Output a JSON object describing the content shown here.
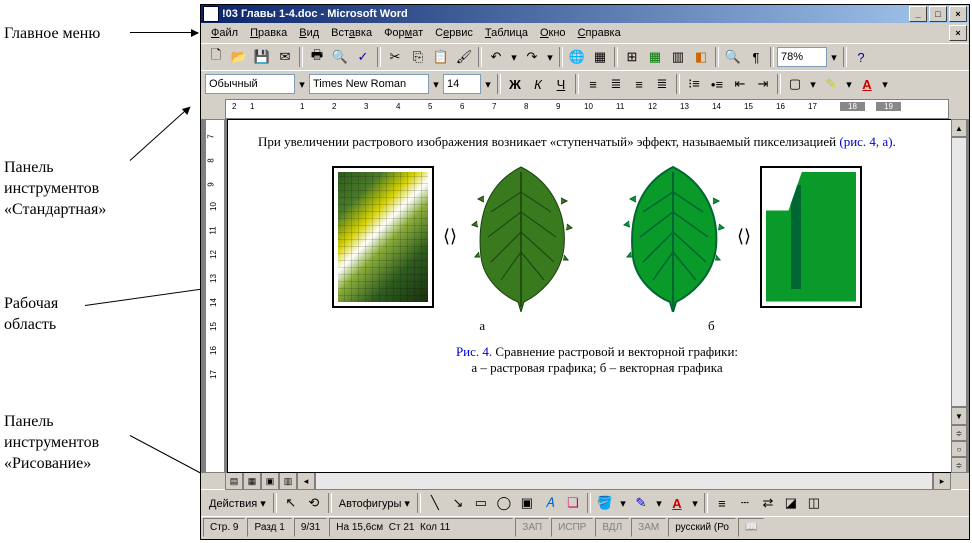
{
  "annotations": {
    "menu": "Главное меню",
    "standard": "Панель\nинструментов\n«Стандартная»",
    "workarea": "Рабочая\nобласть",
    "drawing": "Панель\nинструментов\n«Рисование»"
  },
  "title": "!03 Главы 1-4.doc - Microsoft Word",
  "menus": [
    "Файл",
    "Правка",
    "Вид",
    "Вставка",
    "Формат",
    "Сервис",
    "Таблица",
    "Окно",
    "Справка"
  ],
  "standard_toolbar": {
    "zoom": "78%"
  },
  "format_toolbar": {
    "style": "Обычный",
    "font": "Times New Roman",
    "size": "14"
  },
  "document": {
    "paragraph": "При увеличении растрового изображения возникает «ступенчатый» эффект, называемый пикселизацией ",
    "paragraph_link": "(рис. 4, а)",
    "label_a": "а",
    "label_b": "б",
    "caption_num": "Рис. 4.",
    "caption_text": " Сравнение растровой и векторной графики:",
    "caption_sub": "а – растровая графика; б – векторная графика"
  },
  "drawbar": {
    "actions": "Действия",
    "autoshapes": "Автофигуры"
  },
  "status": {
    "page": "Стр. 9",
    "section": "Разд 1",
    "pages": "9/31",
    "at": "На 15,6см",
    "line": "Ст 21",
    "col": "Кол 11",
    "rec": "ЗАП",
    "trk": "ИСПР",
    "ext": "ВДЛ",
    "ovr": "ЗАМ",
    "lang": "русский (Ро"
  }
}
